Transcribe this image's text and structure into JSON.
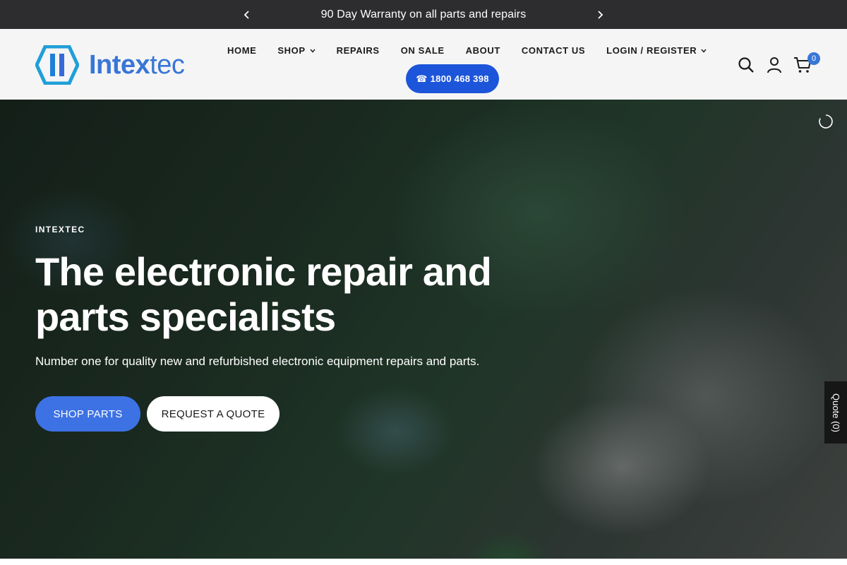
{
  "announcement": {
    "text": "90 Day Warranty on all parts and repairs"
  },
  "brand": {
    "name_bold": "Intex",
    "name_light": "tec",
    "accent_color": "#3876d6"
  },
  "nav": {
    "items": [
      {
        "label": "HOME"
      },
      {
        "label": "SHOP",
        "dropdown": true
      },
      {
        "label": "REPAIRS"
      },
      {
        "label": "ON SALE"
      },
      {
        "label": "ABOUT"
      },
      {
        "label": "CONTACT US"
      },
      {
        "label": "LOGIN / REGISTER",
        "dropdown": true
      }
    ],
    "phone": "☎ 1800 468 398"
  },
  "header_icons": {
    "search": "search-icon",
    "account": "user-icon",
    "cart": "cart-icon",
    "cart_count": "0"
  },
  "hero": {
    "eyebrow": "INTEXTEC",
    "headline": "The electronic repair and parts specialists",
    "subhead": "Number one for quality new and refurbished electronic equipment repairs and parts.",
    "primary_button": "SHOP PARTS",
    "secondary_button": "REQUEST A QUOTE"
  },
  "quote_tab": {
    "label": "Quote (0)"
  },
  "colors": {
    "announce_bg": "#2d2d2f",
    "phone_button": "#1c55d9",
    "primary_button": "#3d72e4"
  }
}
